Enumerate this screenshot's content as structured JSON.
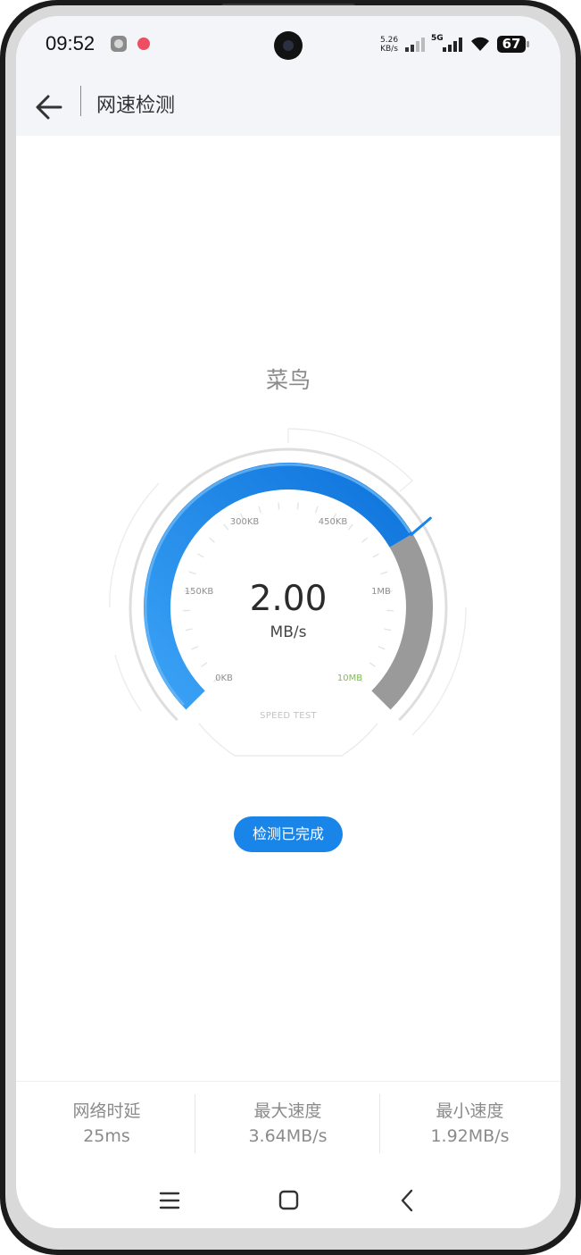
{
  "status_bar": {
    "time": "09:52",
    "net_speed_value": "5.26",
    "net_speed_unit": "KB/s",
    "network_type": "5G",
    "battery": "67"
  },
  "app_bar": {
    "title": "网速检测",
    "back_icon": "arrow-left-icon"
  },
  "server": {
    "name": "菜鸟"
  },
  "gauge": {
    "value": "2.00",
    "unit": "MB/s",
    "caption": "SPEED TEST",
    "ticks": [
      "0KB",
      "150KB",
      "300KB",
      "450KB",
      "1MB",
      "10MB"
    ],
    "progress_fraction": 0.72,
    "colors": {
      "progress": "#1a85e8",
      "remaining": "#9a9a9a",
      "highlight_tick": "#7cc24a"
    }
  },
  "status_button": {
    "label": "检测已完成"
  },
  "stats": [
    {
      "label": "网络时延",
      "value": "25ms"
    },
    {
      "label": "最大速度",
      "value": "3.64MB/s"
    },
    {
      "label": "最小速度",
      "value": "1.92MB/s"
    }
  ],
  "nav": {
    "menu_icon": "menu-icon",
    "home_icon": "home-square-icon",
    "back_icon": "chevron-left-icon"
  }
}
